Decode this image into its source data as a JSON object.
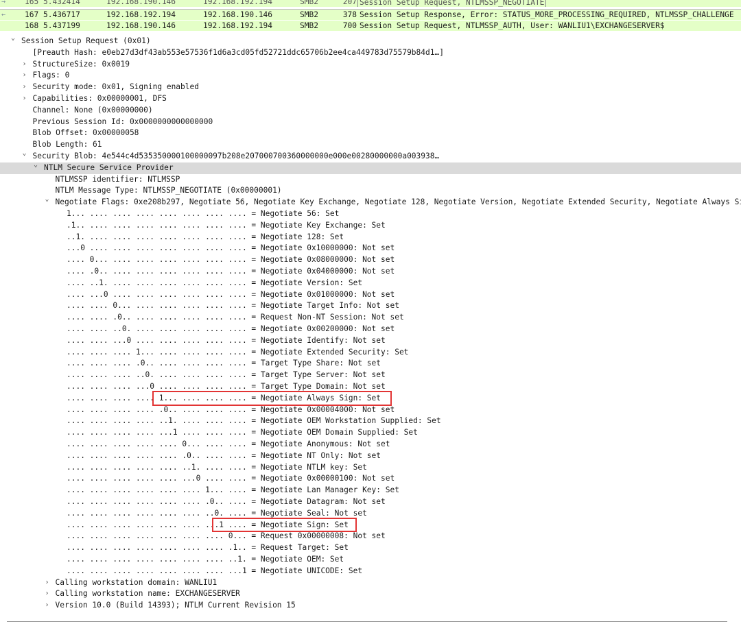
{
  "packet_list": {
    "rows": [
      {
        "no": "165",
        "time": "5.432414",
        "source": "192.168.190.146",
        "destination": "192.168.192.194",
        "protocol": "SMB2",
        "length": "207",
        "info": "Session Setup Request, NTLMSSP_NEGOTIATE"
      },
      {
        "no": "167",
        "time": "5.436717",
        "source": "192.168.192.194",
        "destination": "192.168.190.146",
        "protocol": "SMB2",
        "length": "378",
        "info": "Session Setup Response, Error: STATUS_MORE_PROCESSING_REQUIRED, NTLMSSP_CHALLENGE"
      },
      {
        "no": "168",
        "time": "5.437199",
        "source": "192.168.190.146",
        "destination": "192.168.192.194",
        "protocol": "SMB2",
        "length": "700",
        "info": "Session Setup Request, NTLMSSP_AUTH, User: WANLIU1\\EXCHANGESERVER$"
      }
    ],
    "row_color": "#e4ffc7"
  },
  "tree": {
    "lines": [
      {
        "indent": 0,
        "toggle": "expanded",
        "text": "Session Setup Request (0x01)"
      },
      {
        "indent": 1,
        "toggle": "none",
        "text": "[Preauth Hash: e0eb27d3df43ab553e57536f1d6a3cd05fd52721ddc65706b2ee4ca449783d75579b84d1…]"
      },
      {
        "indent": 1,
        "toggle": "collapsed",
        "text": "StructureSize: 0x0019"
      },
      {
        "indent": 1,
        "toggle": "collapsed",
        "text": "Flags: 0"
      },
      {
        "indent": 1,
        "toggle": "collapsed",
        "text": "Security mode: 0x01, Signing enabled"
      },
      {
        "indent": 1,
        "toggle": "collapsed",
        "text": "Capabilities: 0x00000001, DFS"
      },
      {
        "indent": 1,
        "toggle": "none",
        "text": "Channel: None (0x00000000)"
      },
      {
        "indent": 1,
        "toggle": "none",
        "text": "Previous Session Id: 0x0000000000000000"
      },
      {
        "indent": 1,
        "toggle": "none",
        "text": "Blob Offset: 0x00000058"
      },
      {
        "indent": 1,
        "toggle": "none",
        "text": "Blob Length: 61"
      },
      {
        "indent": 1,
        "toggle": "expanded",
        "text": "Security Blob: 4e544c4d535350000100000097b208e207000700360000000e000e00280000000a003938…"
      },
      {
        "indent": 2,
        "toggle": "expanded",
        "text": "NTLM Secure Service Provider",
        "selected": true
      },
      {
        "indent": 3,
        "toggle": "none",
        "text": "NTLMSSP identifier: NTLMSSP"
      },
      {
        "indent": 3,
        "toggle": "none",
        "text": "NTLM Message Type: NTLMSSP_NEGOTIATE (0x00000001)"
      },
      {
        "indent": 3,
        "toggle": "expanded",
        "text": "Negotiate Flags: 0xe208b297, Negotiate 56, Negotiate Key Exchange, Negotiate 128, Negotiate Version, Negotiate Extended Security, Negotiate Always Si"
      },
      {
        "indent": 4,
        "toggle": "none",
        "text": "1... .... .... .... .... .... .... .... = Negotiate 56: Set"
      },
      {
        "indent": 4,
        "toggle": "none",
        "text": ".1.. .... .... .... .... .... .... .... = Negotiate Key Exchange: Set"
      },
      {
        "indent": 4,
        "toggle": "none",
        "text": "..1. .... .... .... .... .... .... .... = Negotiate 128: Set"
      },
      {
        "indent": 4,
        "toggle": "none",
        "text": "...0 .... .... .... .... .... .... .... = Negotiate 0x10000000: Not set"
      },
      {
        "indent": 4,
        "toggle": "none",
        "text": ".... 0... .... .... .... .... .... .... = Negotiate 0x08000000: Not set"
      },
      {
        "indent": 4,
        "toggle": "none",
        "text": ".... .0.. .... .... .... .... .... .... = Negotiate 0x04000000: Not set"
      },
      {
        "indent": 4,
        "toggle": "none",
        "text": ".... ..1. .... .... .... .... .... .... = Negotiate Version: Set"
      },
      {
        "indent": 4,
        "toggle": "none",
        "text": ".... ...0 .... .... .... .... .... .... = Negotiate 0x01000000: Not set"
      },
      {
        "indent": 4,
        "toggle": "none",
        "text": ".... .... 0... .... .... .... .... .... = Negotiate Target Info: Not set"
      },
      {
        "indent": 4,
        "toggle": "none",
        "text": ".... .... .0.. .... .... .... .... .... = Request Non-NT Session: Not set"
      },
      {
        "indent": 4,
        "toggle": "none",
        "text": ".... .... ..0. .... .... .... .... .... = Negotiate 0x00200000: Not set"
      },
      {
        "indent": 4,
        "toggle": "none",
        "text": ".... .... ...0 .... .... .... .... .... = Negotiate Identify: Not set"
      },
      {
        "indent": 4,
        "toggle": "none",
        "text": ".... .... .... 1... .... .... .... .... = Negotiate Extended Security: Set"
      },
      {
        "indent": 4,
        "toggle": "none",
        "text": ".... .... .... .0.. .... .... .... .... = Target Type Share: Not set"
      },
      {
        "indent": 4,
        "toggle": "none",
        "text": ".... .... .... ..0. .... .... .... .... = Target Type Server: Not set"
      },
      {
        "indent": 4,
        "toggle": "none",
        "text": ".... .... .... ...0 .... .... .... .... = Target Type Domain: Not set"
      },
      {
        "indent": 4,
        "toggle": "none",
        "text": ".... .... .... .... 1... .... .... .... = Negotiate Always Sign: Set",
        "highlight": "always-sign"
      },
      {
        "indent": 4,
        "toggle": "none",
        "text": ".... .... .... .... .0.. .... .... .... = Negotiate 0x00004000: Not set"
      },
      {
        "indent": 4,
        "toggle": "none",
        "text": ".... .... .... .... ..1. .... .... .... = Negotiate OEM Workstation Supplied: Set"
      },
      {
        "indent": 4,
        "toggle": "none",
        "text": ".... .... .... .... ...1 .... .... .... = Negotiate OEM Domain Supplied: Set"
      },
      {
        "indent": 4,
        "toggle": "none",
        "text": ".... .... .... .... .... 0... .... .... = Negotiate Anonymous: Not set"
      },
      {
        "indent": 4,
        "toggle": "none",
        "text": ".... .... .... .... .... .0.. .... .... = Negotiate NT Only: Not set"
      },
      {
        "indent": 4,
        "toggle": "none",
        "text": ".... .... .... .... .... ..1. .... .... = Negotiate NTLM key: Set"
      },
      {
        "indent": 4,
        "toggle": "none",
        "text": ".... .... .... .... .... ...0 .... .... = Negotiate 0x00000100: Not set"
      },
      {
        "indent": 4,
        "toggle": "none",
        "text": ".... .... .... .... .... .... 1... .... = Negotiate Lan Manager Key: Set"
      },
      {
        "indent": 4,
        "toggle": "none",
        "text": ".... .... .... .... .... .... .0.. .... = Negotiate Datagram: Not set"
      },
      {
        "indent": 4,
        "toggle": "none",
        "text": ".... .... .... .... .... .... ..0. .... = Negotiate Seal: Not set"
      },
      {
        "indent": 4,
        "toggle": "none",
        "text": ".... .... .... .... .... .... ...1 .... = Negotiate Sign: Set",
        "highlight": "sign"
      },
      {
        "indent": 4,
        "toggle": "none",
        "text": ".... .... .... .... .... .... .... 0... = Request 0x00000008: Not set"
      },
      {
        "indent": 4,
        "toggle": "none",
        "text": ".... .... .... .... .... .... .... .1.. = Request Target: Set"
      },
      {
        "indent": 4,
        "toggle": "none",
        "text": ".... .... .... .... .... .... .... ..1. = Negotiate OEM: Set"
      },
      {
        "indent": 4,
        "toggle": "none",
        "text": ".... .... .... .... .... .... .... ...1 = Negotiate UNICODE: Set"
      },
      {
        "indent": 3,
        "toggle": "collapsed",
        "text": "Calling workstation domain: WANLIU1"
      },
      {
        "indent": 3,
        "toggle": "collapsed",
        "text": "Calling workstation name: EXCHANGESERVER"
      },
      {
        "indent": 3,
        "toggle": "collapsed",
        "text": "Version 10.0 (Build 14393); NTLM Current Revision 15"
      }
    ]
  },
  "highlight_color": "#e23434",
  "selected_row_color": "#dadada",
  "icons": {
    "expanded": "chevron-down-icon",
    "collapsed": "chevron-right-icon",
    "packet_link": "arrow-left-icon"
  }
}
